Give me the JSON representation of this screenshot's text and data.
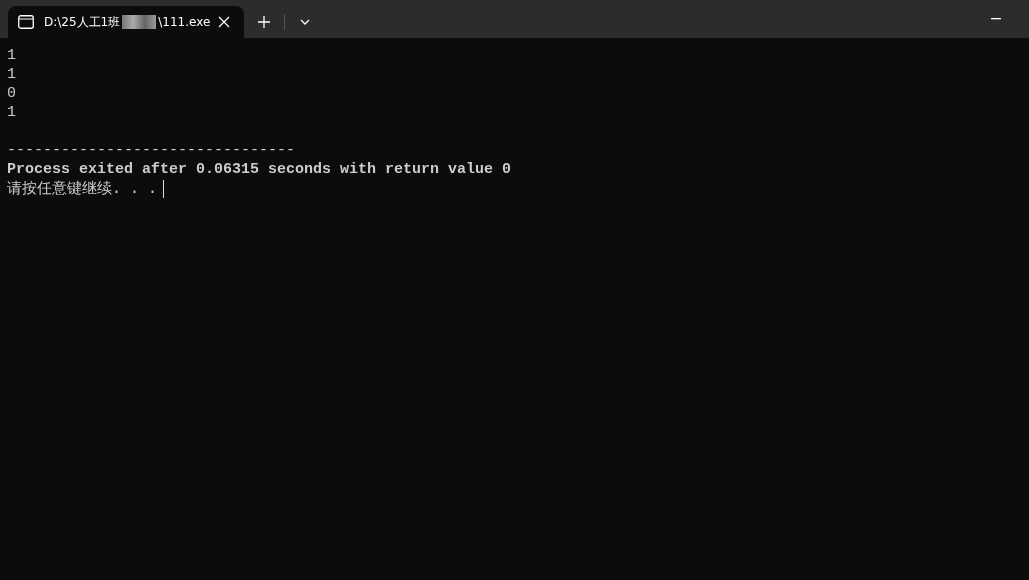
{
  "tab": {
    "title_start": "D:\\25人工1班",
    "title_end": "\\111.exe",
    "selected": true
  },
  "console": {
    "output_lines": [
      "1",
      "1",
      "0",
      "1"
    ],
    "separator": "--------------------------------",
    "message": "Process exited after 0.06315 seconds with return value 0",
    "prompt": "请按任意键继续. . ."
  }
}
